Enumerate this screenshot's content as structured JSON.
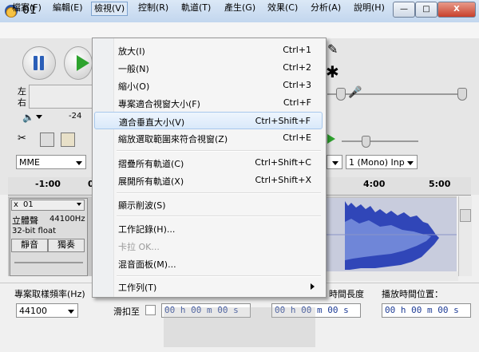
{
  "window": {
    "title": "01",
    "minimize_glyph": "—",
    "maximize_glyph": "□",
    "close_glyph": "X"
  },
  "menubar": {
    "items": [
      "檔案(F)",
      "編輯(E)",
      "檢視(V)",
      "控制(R)",
      "軌道(T)",
      "產生(G)",
      "效果(C)",
      "分析(A)",
      "說明(H)"
    ]
  },
  "toolbar": {
    "meter_left_label": "左",
    "meter_right_label": "右",
    "meter_value": "-24",
    "pencil_icon": "✎",
    "multi_tool_icon": "✱",
    "host_value": "MME",
    "channels_value": "1 (Mono) Inp"
  },
  "ruler": {
    "labels": [
      "-1:00",
      "0",
      "4:00",
      "5:00"
    ]
  },
  "track": {
    "name": "立體聲",
    "rate": "44100Hz",
    "format": "32-bit float",
    "mute_label": "靜音",
    "solo_label": "獨奏"
  },
  "view_menu": {
    "items": [
      {
        "label": "放大(I)",
        "shortcut": "Ctrl+1"
      },
      {
        "label": "一般(N)",
        "shortcut": "Ctrl+2"
      },
      {
        "label": "縮小(O)",
        "shortcut": "Ctrl+3"
      },
      {
        "label": "專案適合視窗大小(F)",
        "shortcut": "Ctrl+F"
      },
      {
        "label": "適合垂直大小(V)",
        "shortcut": "Ctrl+Shift+F"
      },
      {
        "label": "縮放選取範圍來符合視窗(Z)",
        "shortcut": "Ctrl+E"
      },
      {
        "label": "摺疊所有軌道(C)",
        "shortcut": "Ctrl+Shift+C"
      },
      {
        "label": "展開所有軌道(X)",
        "shortcut": "Ctrl+Shift+X"
      },
      {
        "label": "顯示削波(S)",
        "shortcut": ""
      },
      {
        "label": "工作記錄(H)...",
        "shortcut": ""
      },
      {
        "label": "卡拉 OK...",
        "shortcut": ""
      },
      {
        "label": "混音面板(M)...",
        "shortcut": ""
      },
      {
        "label": "工作列(T)",
        "shortcut": ""
      }
    ]
  },
  "selection_bar": {
    "rate_label": "專案取樣頻率(Hz)",
    "rate_value": "44100",
    "snap_label": "滑扣至",
    "length_label": "時間長度",
    "position_label": "播放時間位置：",
    "time_value": "00 h 00 m 00 s"
  },
  "colors": {
    "accent": "#2b5fb8",
    "play": "#2ea32e",
    "waveform_dark": "#3046b8",
    "waveform_light": "#6f86d8"
  }
}
